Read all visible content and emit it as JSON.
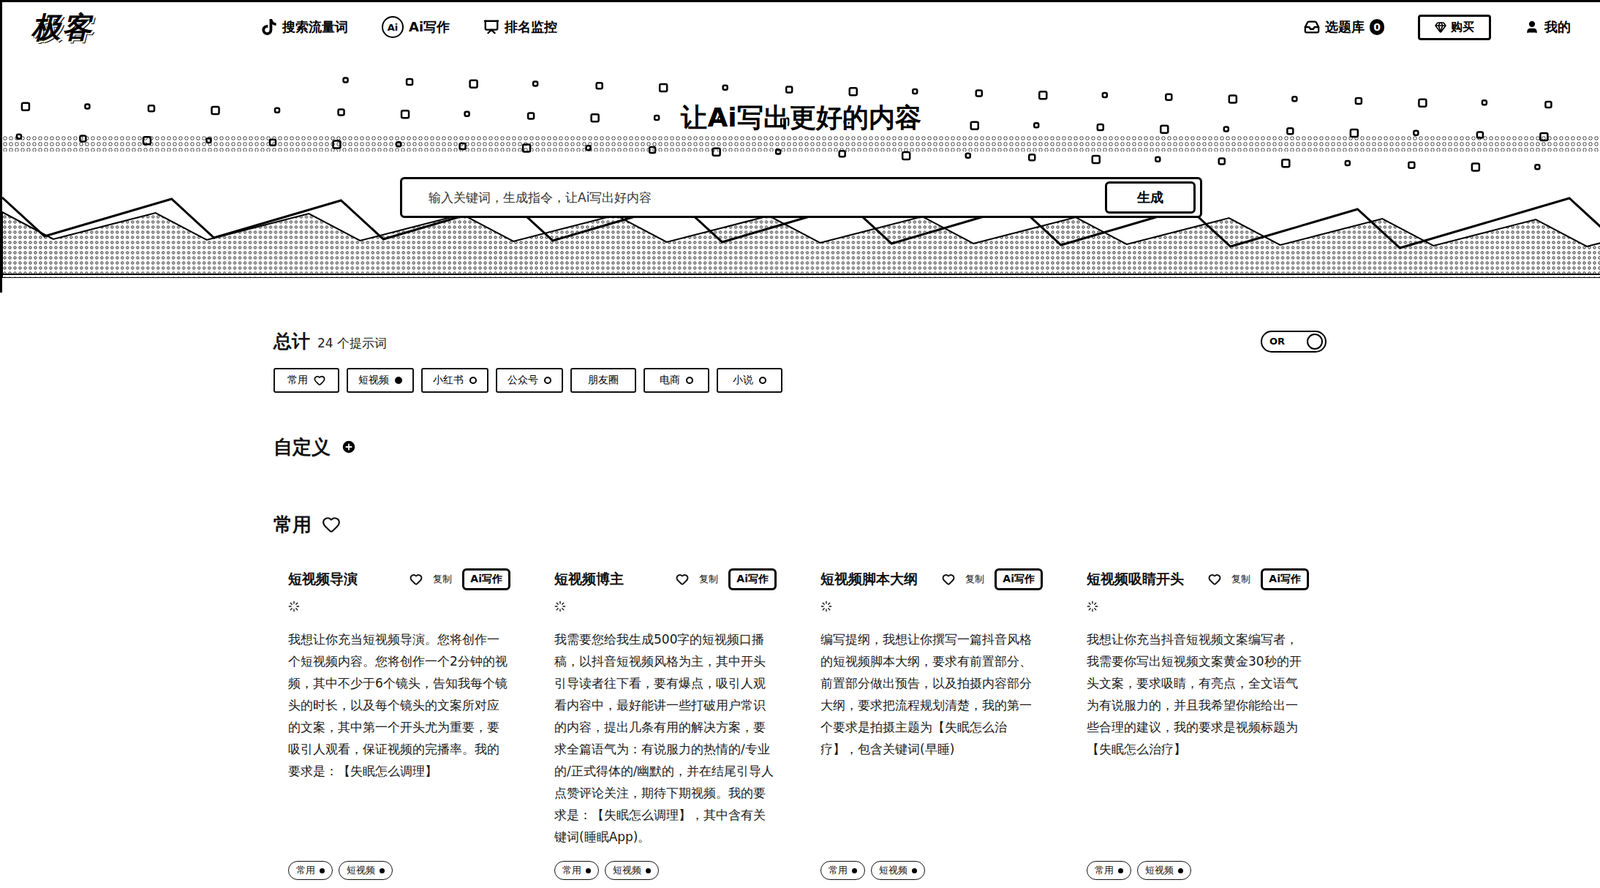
{
  "header": {
    "logo": "极客",
    "nav": [
      {
        "label": "搜索流量词",
        "kind": "tiktok"
      },
      {
        "label": "Ai写作",
        "kind": "ai",
        "icon_text": "Ai"
      },
      {
        "label": "排名监控",
        "kind": "ranking"
      }
    ],
    "topic_library": {
      "label": "选题库",
      "count": "0"
    },
    "buy": "购买",
    "mine": "我的"
  },
  "hero": {
    "title": "让Ai写出更好的内容",
    "search": {
      "placeholder": "输入关键词，生成指令，让Ai写出好内容",
      "button": "生成"
    }
  },
  "summary": {
    "label": "总计",
    "count": "24 个提示词"
  },
  "or_toggle": {
    "label": "OR",
    "on": false
  },
  "filters": [
    {
      "label": "常用",
      "kind": "heart",
      "selected": false
    },
    {
      "label": "短视频",
      "kind": "dot",
      "selected": true
    },
    {
      "label": "小红书",
      "kind": "dot",
      "selected": false
    },
    {
      "label": "公众号",
      "kind": "dot",
      "selected": false
    },
    {
      "label": "朋友圈",
      "kind": "none",
      "selected": false
    },
    {
      "label": "电商",
      "kind": "dot",
      "selected": false
    },
    {
      "label": "小说",
      "kind": "dot",
      "selected": false
    }
  ],
  "custom": {
    "title": "自定义"
  },
  "section": {
    "title": "常用"
  },
  "cards": [
    {
      "title": "短视频导演",
      "copy": "复制",
      "action": "Ai写作",
      "body": "我想让你充当短视频导演。您将创作一个短视频内容。您将创作一个2分钟的视频，其中不少于6个镜头，告知我每个镜头的时长，以及每个镜头的文案所对应的文案，其中第一个开头尤为重要，要吸引人观看，保证视频的完播率。我的要求是：【失眠怎么调理】",
      "tags": [
        "常用",
        "短视频"
      ]
    },
    {
      "title": "短视频博主",
      "copy": "复制",
      "action": "Ai写作",
      "body": "我需要您给我生成500字的短视频口播稿，以抖音短视频风格为主，其中开头引导读者往下看，要有爆点，吸引人观看内容中，最好能讲一些打破用户常识的内容，提出几条有用的解决方案，要求全篇语气为：有说服力的热情的/专业的/正式得体的/幽默的，并在结尾引导人点赞评论关注，期待下期视频。我的要求是：【失眠怎么调理】，其中含有关键词(睡眠App)。",
      "tags": [
        "常用",
        "短视频"
      ]
    },
    {
      "title": "短视频脚本大纲",
      "copy": "复制",
      "action": "Ai写作",
      "body": "编写提纲，我想让你撰写一篇抖音风格的短视频脚本大纲，要求有前置部分、前置部分做出预告，以及拍摄内容部分大纲，要求把流程规划清楚，我的第一个要求是拍摄主题为【失眠怎么治疗】，包含关键词(早睡)",
      "tags": [
        "常用",
        "短视频"
      ]
    },
    {
      "title": "短视频吸睛开头",
      "copy": "复制",
      "action": "Ai写作",
      "body": "我想让你充当抖音短视频文案编写者，我需要你写出短视频文案黄金30秒的开头文案，要求吸睛，有亮点，全文语气为有说服力的，并且我希望你能给出一些合理的建议，我的要求是视频标题为【失眠怎么治疗】",
      "tags": [
        "常用",
        "短视频"
      ]
    }
  ]
}
